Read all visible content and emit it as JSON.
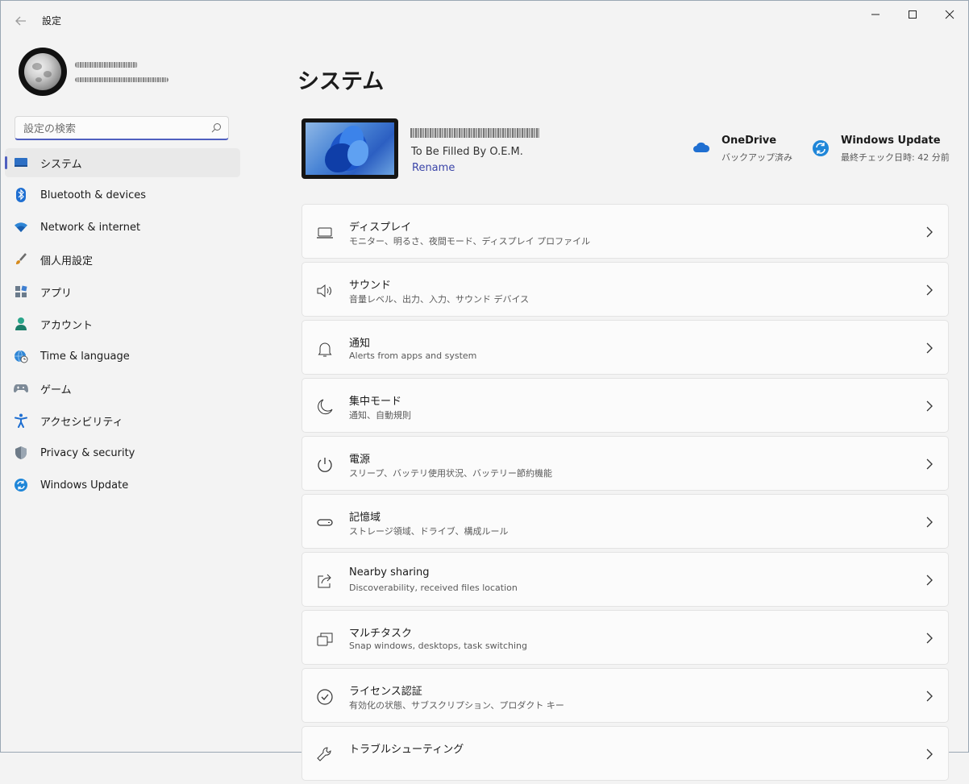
{
  "window": {
    "title": "設定",
    "back_icon": "back-arrow-icon"
  },
  "user": {
    "avatar": "moon-avatar"
  },
  "search": {
    "placeholder": "設定の検索"
  },
  "sidebar": {
    "items": [
      {
        "label": "システム",
        "icon": "system-icon",
        "active": true
      },
      {
        "label": "Bluetooth & devices",
        "icon": "bluetooth-icon"
      },
      {
        "label": "Network & internet",
        "icon": "wifi-icon"
      },
      {
        "label": "個人用設定",
        "icon": "brush-icon"
      },
      {
        "label": "アプリ",
        "icon": "apps-icon"
      },
      {
        "label": "アカウント",
        "icon": "account-icon"
      },
      {
        "label": "Time & language",
        "icon": "globe-clock-icon"
      },
      {
        "label": "ゲーム",
        "icon": "gamepad-icon"
      },
      {
        "label": "アクセシビリティ",
        "icon": "accessibility-icon"
      },
      {
        "label": "Privacy & security",
        "icon": "shield-icon"
      },
      {
        "label": "Windows Update",
        "icon": "update-icon"
      }
    ]
  },
  "main": {
    "title": "システム",
    "device": {
      "model": "To Be Filled By O.E.M.",
      "rename_label": "Rename"
    },
    "quick_status": [
      {
        "title": "OneDrive",
        "subtitle": "バックアップ済み",
        "icon": "cloud-icon",
        "color": "#1f6fd1"
      },
      {
        "title": "Windows Update",
        "subtitle": "最終チェック日時: 42 分前",
        "icon": "update-icon",
        "color": "#1f86d8"
      }
    ],
    "cards": [
      {
        "title": "ディスプレイ",
        "subtitle": "モニター、明るさ、夜間モード、ディスプレイ プロファイル",
        "icon": "display-icon"
      },
      {
        "title": "サウンド",
        "subtitle": "音量レベル、出力、入力、サウンド デバイス",
        "icon": "speaker-icon"
      },
      {
        "title": "通知",
        "subtitle": "Alerts from apps and system",
        "icon": "bell-icon"
      },
      {
        "title": "集中モード",
        "subtitle": "通知、自動規則",
        "icon": "moon-icon"
      },
      {
        "title": "電源",
        "subtitle": "スリープ、バッテリ使用状況、バッテリー節約機能",
        "icon": "power-icon"
      },
      {
        "title": "記憶域",
        "subtitle": "ストレージ領域、ドライブ、構成ルール",
        "icon": "storage-icon"
      },
      {
        "title": "Nearby sharing",
        "subtitle": "Discoverability, received files location",
        "icon": "share-icon"
      },
      {
        "title": "マルチタスク",
        "subtitle": "Snap windows, desktops, task switching",
        "icon": "multitask-icon"
      },
      {
        "title": "ライセンス認証",
        "subtitle": "有効化の状態、サブスクリプション、プロダクト キー",
        "icon": "check-circle-icon"
      },
      {
        "title": "トラブルシューティング",
        "subtitle": "",
        "icon": "wrench-icon"
      }
    ]
  },
  "colors": {
    "accent": "#4f5fbf",
    "link": "#3b45a8",
    "background": "#f3f3f3",
    "card": "#fbfbfb"
  }
}
